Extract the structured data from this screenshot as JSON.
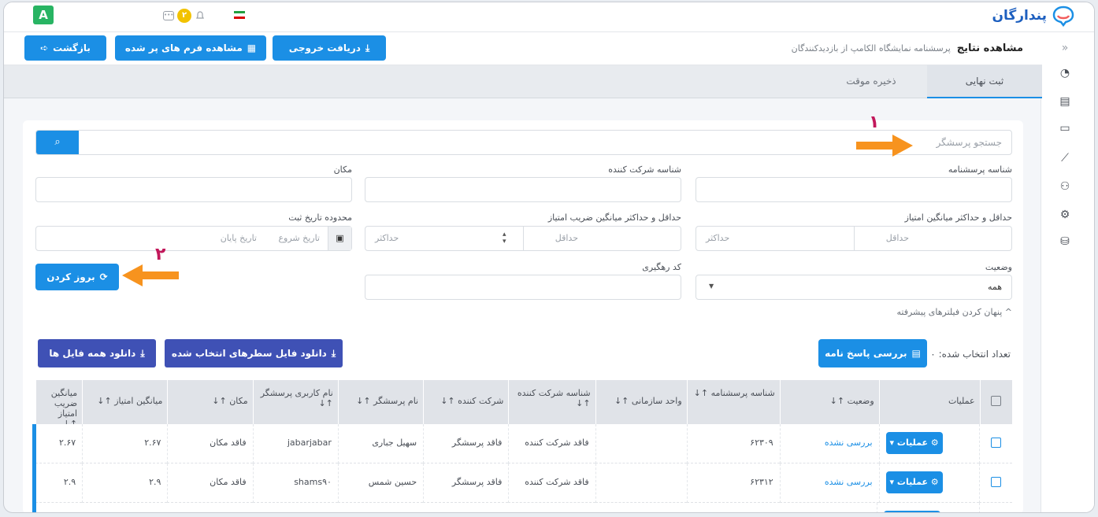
{
  "topbar": {
    "user_initial": "A",
    "notification_count": "۲",
    "brand_name": "پندارگان"
  },
  "header": {
    "title": "مشاهده نتایج",
    "subtitle": "پرسشنامه نمایشگاه الکامپ از بازدیدکنندگان",
    "back_label": "بازگشت",
    "view_forms_label": "مشاهده فرم های پر شده",
    "export_label": "دریافت خروجی"
  },
  "tabs": [
    {
      "label": "ثبت نهایی",
      "active": true
    },
    {
      "label": "ذخیره موقت",
      "active": false
    }
  ],
  "filters": {
    "search_placeholder": "جستجو پرسشگر",
    "questionnaire_id_label": "شناسه پرسشنامه",
    "company_id_label": "شناسه شرکت کننده",
    "location_label": "مکان",
    "score_range_label": "حداقل و حداکثر میانگین امتیاز",
    "coef_range_label": "حداقل و حداکثر میانگین ضریب امتیاز",
    "date_range_label": "محدوده تاریخ ثبت",
    "min_placeholder": "حداقل",
    "max_placeholder": "حداکثر",
    "start_date_placeholder": "تاریخ شروع",
    "end_date_placeholder": "تاریخ پایان",
    "status_label": "وضعیت",
    "status_value": "همه",
    "tracking_label": "کد رهگیری",
    "refresh_label": "بروز کردن",
    "hide_advanced": "پنهان کردن فیلترهای پیشرفته"
  },
  "actions": {
    "selected_count_label": "تعداد انتخاب شده:",
    "selected_count": "۰",
    "review_label": "بررسی پاسخ نامه",
    "download_selected_label": "دانلود فایل سطرهای انتخاب شده",
    "download_all_label": "دانلود همه فایل ها"
  },
  "table": {
    "headers": [
      "عملیات",
      "وضعیت ↑↓",
      "شناسه پرسشنامه ↑↓",
      "واحد سازمانی ↑↓",
      "شناسه شرکت کننده ↑↓",
      "شرکت کننده ↑↓",
      "نام پرسشگر ↑↓",
      "نام کاربری پرسشگر ↑↓",
      "مکان ↑↓",
      "میانگین امتیاز ↑↓",
      "میانگین ضریب امتیاز ↑↓"
    ],
    "ops_label": "عملیات",
    "rows": [
      {
        "status": "بررسی نشده",
        "qid": "۶۲۳۰۹",
        "unit": "",
        "company_id": "فاقد شرکت کننده",
        "company": "فاقد پرسشگر",
        "name": "سهیل جباری",
        "username": "jabarjabar",
        "location": "فاقد مکان",
        "avg": "۲.۶۷",
        "coef": "۲.۶۷"
      },
      {
        "status": "بررسی نشده",
        "qid": "۶۲۳۱۲",
        "unit": "",
        "company_id": "فاقد شرکت کننده",
        "company": "فاقد پرسشگر",
        "name": "حسین شمس",
        "username": "shams۹۰",
        "location": "فاقد مکان",
        "avg": "۲.۹",
        "coef": "۲.۹"
      }
    ]
  },
  "annotations": {
    "one": "۱",
    "two": "۲"
  },
  "colors": {
    "primary": "#1b8fe5",
    "indigo": "#3f51b5",
    "arrow": "#f7931e",
    "marker": "#c2185b",
    "success": "#28b463"
  }
}
